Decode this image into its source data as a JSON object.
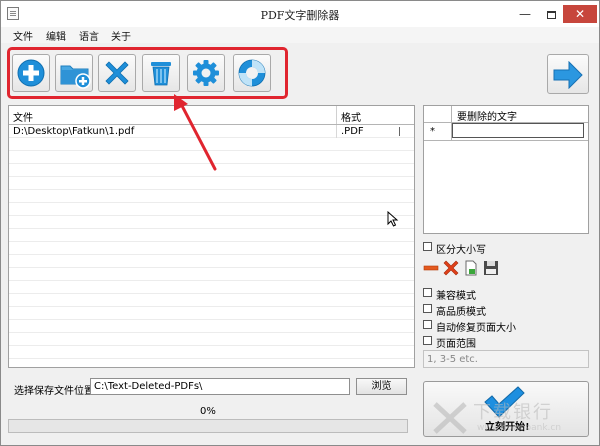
{
  "window": {
    "title": "PDF文字删除器",
    "min_glyph": "—",
    "close_glyph": "✕"
  },
  "menu": {
    "items": [
      "文件",
      "编辑",
      "语言",
      "关于"
    ]
  },
  "toolbar": {
    "buttons": [
      {
        "name": "add-file",
        "icon": "plus-circle-icon"
      },
      {
        "name": "add-folder",
        "icon": "folder-add-icon"
      },
      {
        "name": "remove",
        "icon": "x-icon"
      },
      {
        "name": "clear",
        "icon": "trash-icon"
      },
      {
        "name": "settings",
        "icon": "gear-icon"
      },
      {
        "name": "help",
        "icon": "lifebuoy-icon"
      }
    ],
    "next_icon": "arrow-right-icon",
    "highlight_color": "#e0252f"
  },
  "file_list": {
    "columns": [
      "文件",
      "格式"
    ],
    "rows": [
      {
        "path": "D:\\Desktop\\Fatkun\\1.pdf",
        "format": ".PDF"
      }
    ]
  },
  "words_table": {
    "header": "要删除的文字",
    "new_row_marker": "*"
  },
  "options": {
    "case_sensitive": "区分大小写",
    "compat_mode": "兼容模式",
    "high_quality": "高品质模式",
    "auto_repair": "自动修复页面大小",
    "page_range": "页面范围",
    "range_placeholder": "1, 3-5 etc."
  },
  "save": {
    "label": "选择保存文件位置",
    "path": "C:\\Text-Deleted-PDFs\\",
    "browse": "浏览"
  },
  "progress": {
    "text": "0%",
    "value": 0
  },
  "start": {
    "label": "立刻开始!"
  },
  "watermark": {
    "text": "下载银行",
    "url": "www.downbank.cn"
  },
  "colors": {
    "blue": "#1f8fd9",
    "red": "#e0252f",
    "green": "#06b025"
  }
}
